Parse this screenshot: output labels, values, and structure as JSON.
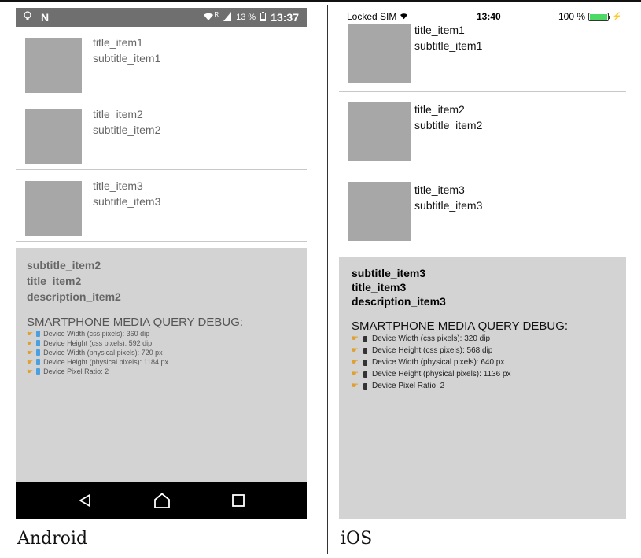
{
  "android": {
    "status": {
      "time": "13:37",
      "battery": "13 %",
      "signal_badge": "R"
    },
    "items": [
      {
        "title": "title_item1",
        "subtitle": "subtitle_item1"
      },
      {
        "title": "title_item2",
        "subtitle": "subtitle_item2"
      },
      {
        "title": "title_item3",
        "subtitle": "subtitle_item3"
      }
    ],
    "detail": {
      "subtitle": "subtitle_item2",
      "title": "title_item2",
      "description": "description_item2"
    },
    "debug": {
      "heading": "SMARTPHONE MEDIA QUERY DEBUG:",
      "lines": [
        "Device Width (css pixels): 360 dip",
        "Device Height (css pixels): 592 dip",
        "Device Width (physical pixels): 720 px",
        "Device Height (physical pixels): 1184 px",
        "Device Pixel Ratio: 2"
      ]
    },
    "nav": [
      "back-icon",
      "home-icon",
      "recents-icon"
    ],
    "caption": "Android"
  },
  "ios": {
    "status": {
      "carrier": "Locked SIM",
      "time": "13:40",
      "battery": "100 %"
    },
    "items": [
      {
        "title": "title_item1",
        "subtitle": "subtitle_item1"
      },
      {
        "title": "title_item2",
        "subtitle": "subtitle_item2"
      },
      {
        "title": "title_item3",
        "subtitle": "subtitle_item3"
      }
    ],
    "detail": {
      "subtitle": "subtitle_item3",
      "title": "title_item3",
      "description": "description_item3"
    },
    "debug": {
      "heading": "SMARTPHONE MEDIA QUERY DEBUG:",
      "lines": [
        "Device Width (css pixels): 320 dip",
        "Device Height (css pixels): 568 dip",
        "Device Width (physical pixels): 640 px",
        "Device Height (physical pixels): 1136 px",
        "Device Pixel Ratio: 2"
      ]
    },
    "caption": "iOS"
  },
  "colors": {
    "thumb": "#a7a7a7",
    "detail_bg": "#d3d3d3",
    "android_status_bg": "#6f6f6f",
    "battery_green": "#4cd964",
    "hand_icon": "#e0a030"
  }
}
